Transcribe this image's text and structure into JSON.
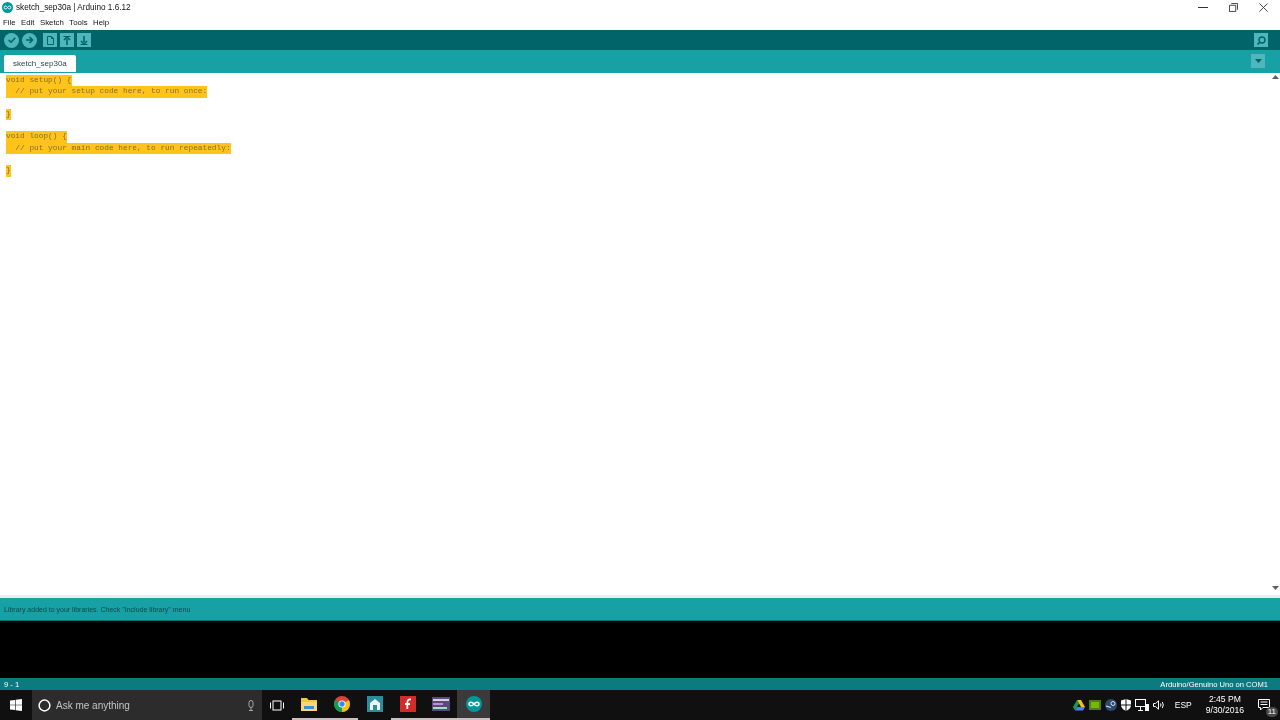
{
  "window": {
    "title": "sketch_sep30a | Arduino 1.6.12"
  },
  "menu": [
    "File",
    "Edit",
    "Sketch",
    "Tools",
    "Help"
  ],
  "tabs": [
    {
      "label": "sketch_sep30a",
      "selected": true
    }
  ],
  "editor": {
    "lines": [
      {
        "kind": "code",
        "text": "void setup() {",
        "selected": true
      },
      {
        "kind": "code",
        "text": "  // put your setup code here, to run once:",
        "selected": true
      },
      {
        "kind": "blank"
      },
      {
        "kind": "code",
        "text": "}",
        "selected": true
      },
      {
        "kind": "blank"
      },
      {
        "kind": "code",
        "text": "void loop() {",
        "selected": true
      },
      {
        "kind": "code",
        "text": "  // put your main code here, to run repeatedly:",
        "selected": true
      },
      {
        "kind": "blank"
      },
      {
        "kind": "code",
        "text": "}",
        "selected": true
      }
    ]
  },
  "message_bar": {
    "text": "Library added to your libraries. Check \"Include library\" menu"
  },
  "status_bar": {
    "line": "9 - 1",
    "board": "Arduino/Genuino Uno on COM1"
  },
  "taskbar": {
    "search": {
      "placeholder": "Ask me anything"
    },
    "apps": [
      {
        "kind": "folder",
        "running": true,
        "selected": false
      },
      {
        "kind": "browser",
        "running": true,
        "selected": false
      },
      {
        "kind": "tile",
        "running": false,
        "selected": false
      },
      {
        "kind": "hook-tile",
        "running": true,
        "selected": false
      },
      {
        "kind": "stripes",
        "running": true,
        "selected": false
      },
      {
        "kind": "infinity",
        "running": true,
        "selected": true
      }
    ],
    "language": "ESP",
    "time": "2:45 PM",
    "date": "9/30/2016",
    "notifications": "11"
  }
}
